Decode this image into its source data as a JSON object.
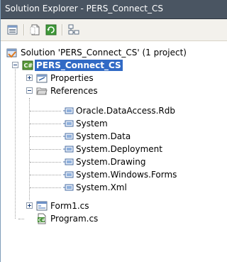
{
  "window": {
    "title": "Solution Explorer - PERS_Connect_CS"
  },
  "toolbar": {
    "buttons": [
      {
        "icon": "properties-icon"
      },
      {
        "icon": "show-all-files-icon"
      },
      {
        "icon": "refresh-icon"
      },
      {
        "icon": "view-class-diagram-icon"
      }
    ]
  },
  "tree": {
    "solution": "Solution 'PERS_Connect_CS' (1 project)",
    "project": "PERS_Connect_CS",
    "properties": "Properties",
    "references": "References",
    "reference_items": [
      "Oracle.DataAccess.Rdb",
      "System",
      "System.Data",
      "System.Deployment",
      "System.Drawing",
      "System.Windows.Forms",
      "System.Xml"
    ],
    "form1": "Form1.cs",
    "program": "Program.cs"
  },
  "colors": {
    "titlebar": "#4a5562",
    "selection": "#316ac5",
    "toolbar_bg": "#f3f1ec"
  }
}
